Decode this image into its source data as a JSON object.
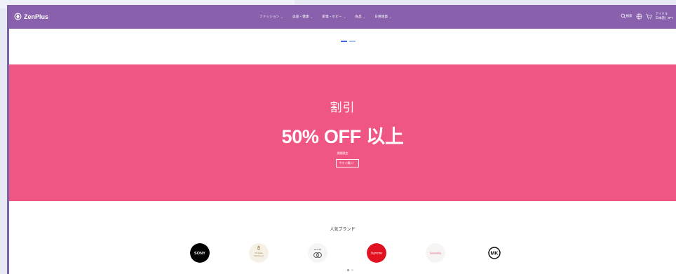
{
  "header": {
    "brand": "ZenPlus",
    "nav": [
      "ファッション",
      "美容・健康",
      "家電・ホビー",
      "食品",
      "日用雑貨"
    ],
    "search_label": "検索",
    "account_line1": "アイドル",
    "account_line2": "日本語 | JPY"
  },
  "hero": {
    "kicker": "割引",
    "title": "50% OFF 以上",
    "subtitle": "期間限定",
    "cta": "今すぐ購入！"
  },
  "brands": {
    "title": "人気ブランド",
    "items": [
      {
        "name": "SONY",
        "icon": "sony-logo-icon"
      },
      {
        "name": "Vivienne Westwood",
        "icon": "vivienne-westwood-logo-icon"
      },
      {
        "name": "GUCCI",
        "icon": "gucci-logo-icon"
      },
      {
        "name": "Supreme",
        "icon": "supreme-logo-icon"
      },
      {
        "name": "Samantha Thavasa",
        "icon": "samantha-thavasa-logo-icon"
      },
      {
        "name": "MK",
        "icon": "michael-kors-logo-icon"
      }
    ]
  },
  "colors": {
    "header": "#8860ab",
    "hero": "#f05683",
    "indicator": "#3f69dd"
  }
}
